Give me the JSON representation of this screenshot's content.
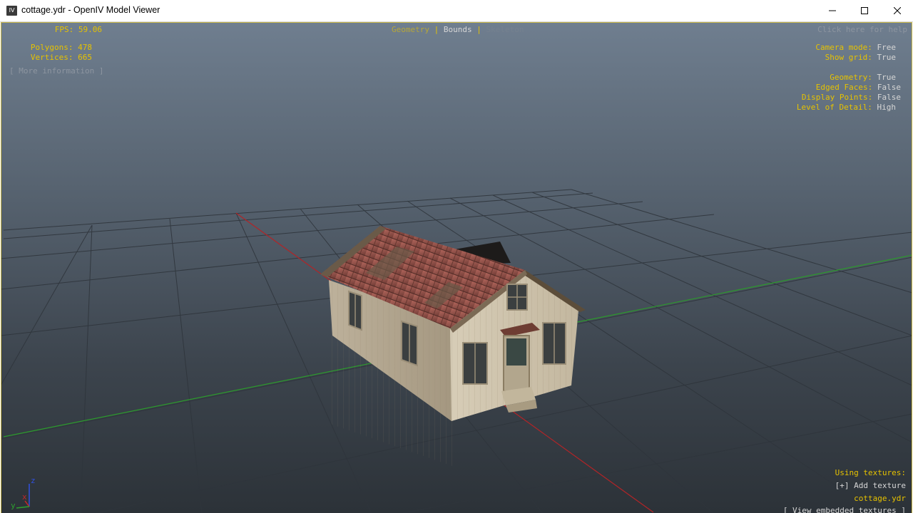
{
  "window": {
    "title": "cottage.ydr - OpenIV Model Viewer",
    "icon": "openiv-icon",
    "icon_text": "IV"
  },
  "hud": {
    "fps_label": "FPS:",
    "fps_value": "59.06",
    "polygons_label": "Polygons:",
    "polygons_value": "478",
    "vertices_label": "Vertices:",
    "vertices_value": "665",
    "more_info": "[ More information ]",
    "tabs": {
      "geometry": "Geometry",
      "sep1": "|",
      "bounds": "Bounds",
      "sep2": "|",
      "skeleton": "Skeleton"
    },
    "help": "Click here for help",
    "camera_mode_label": "Camera mode:",
    "camera_mode_value": "Free",
    "show_grid_label": "Show grid:",
    "show_grid_value": "True",
    "geometry_label": "Geometry:",
    "geometry_value": "True",
    "edged_faces_label": "Edged Faces:",
    "edged_faces_value": "False",
    "display_points_label": "Display Points:",
    "display_points_value": "False",
    "lod_label": "Level of Detail:",
    "lod_value": "High",
    "using_textures": "Using textures:",
    "add_texture": "[+] Add texture",
    "texture_file": "cottage.ydr",
    "view_embedded": "[ View embedded textures ]"
  },
  "axis_gizmo": {
    "x": "x",
    "y": "y",
    "z": "z"
  },
  "colors": {
    "hud_yellow": "#e6c200",
    "hud_white": "#d6d6d6",
    "axis_red": "#c0282a",
    "axis_green": "#2ea02e",
    "axis_blue": "#3050e0"
  }
}
